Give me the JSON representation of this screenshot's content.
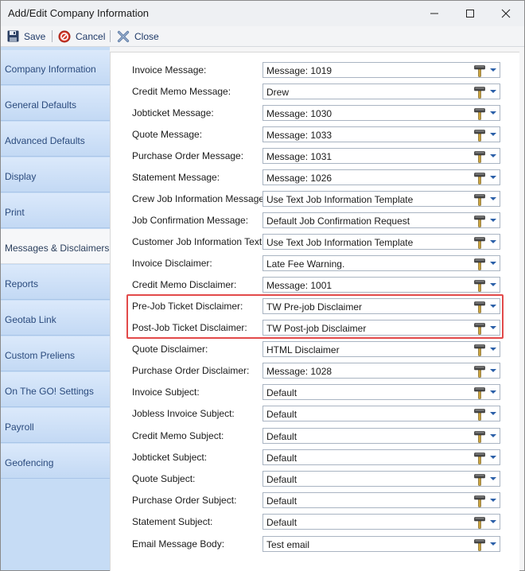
{
  "window": {
    "title": "Add/Edit Company Information",
    "accent": "#e24a4a"
  },
  "toolbar": {
    "save_label": "Save",
    "cancel_label": "Cancel",
    "close_label": "Close"
  },
  "sidebar": {
    "items": [
      {
        "label": "Company Information"
      },
      {
        "label": "General Defaults"
      },
      {
        "label": "Advanced Defaults"
      },
      {
        "label": "Display"
      },
      {
        "label": "Print"
      },
      {
        "label": "Messages & Disclaimers",
        "active": true
      },
      {
        "label": "Reports"
      },
      {
        "label": "Geotab Link"
      },
      {
        "label": "Custom Preliens"
      },
      {
        "label": "On The GO! Settings"
      },
      {
        "label": "Payroll"
      },
      {
        "label": "Geofencing"
      }
    ]
  },
  "form": {
    "rows": [
      {
        "label": "Invoice Message:",
        "value": "Message: 1019"
      },
      {
        "label": "Credit Memo Message:",
        "value": "Drew"
      },
      {
        "label": "Jobticket Message:",
        "value": "Message: 1030"
      },
      {
        "label": "Quote Message:",
        "value": "Message: 1033"
      },
      {
        "label": "Purchase Order Message:",
        "value": "Message: 1031"
      },
      {
        "label": "Statement Message:",
        "value": "Message: 1026"
      },
      {
        "label": "Crew Job Information Message:",
        "value": "Use Text Job Information Template"
      },
      {
        "label": "Job Confirmation Message:",
        "value": "Default Job Confirmation Request"
      },
      {
        "label": "Customer Job Information Text:",
        "value": "Use Text Job Information Template"
      },
      {
        "label": "Invoice Disclaimer:",
        "value": "Late Fee Warning."
      },
      {
        "label": "Credit Memo Disclaimer:",
        "value": "Message: 1001"
      },
      {
        "label": "Pre-Job Ticket Disclaimer:",
        "value": "TW Pre-job Disclaimer",
        "highlighted": true
      },
      {
        "label": "Post-Job Ticket Disclaimer:",
        "value": "TW Post-job Disclaimer",
        "highlighted": true
      },
      {
        "label": "Quote Disclaimer:",
        "value": "HTML Disclaimer"
      },
      {
        "label": "Purchase Order Disclaimer:",
        "value": "Message: 1028"
      },
      {
        "label": "Invoice Subject:",
        "value": "Default"
      },
      {
        "label": "Jobless Invoice Subject:",
        "value": "Default"
      },
      {
        "label": "Credit Memo Subject:",
        "value": "Default"
      },
      {
        "label": "Jobticket Subject:",
        "value": "Default"
      },
      {
        "label": "Quote Subject:",
        "value": "Default"
      },
      {
        "label": "Purchase Order Subject:",
        "value": "Default"
      },
      {
        "label": "Statement Subject:",
        "value": "Default"
      },
      {
        "label": "Email Message Body:",
        "value": "Test email"
      }
    ]
  },
  "icons": {
    "save": "floppy-disk-icon",
    "cancel": "cancel-icon",
    "close": "close-x-icon",
    "field_tool": "hammer-tool-icon",
    "field_dropdown": "chevron-down-icon"
  }
}
